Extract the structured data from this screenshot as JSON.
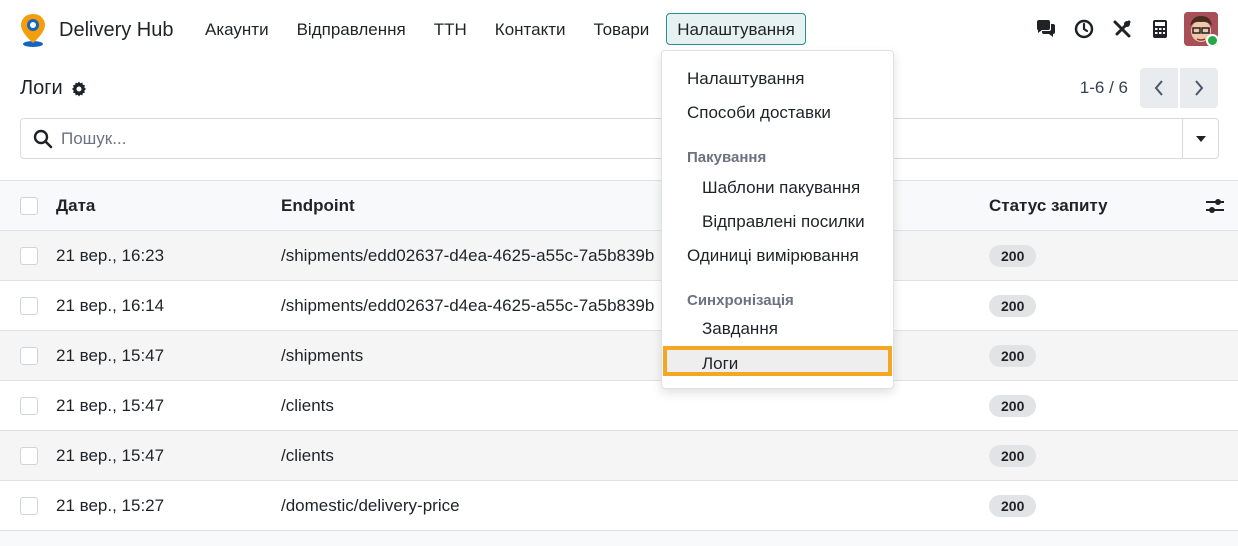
{
  "app": {
    "name": "Delivery Hub"
  },
  "nav": {
    "menu": [
      {
        "label": "Акаунти",
        "active": false
      },
      {
        "label": "Відправлення",
        "active": false
      },
      {
        "label": "ТТН",
        "active": false
      },
      {
        "label": "Контакти",
        "active": false
      },
      {
        "label": "Товари",
        "active": false
      },
      {
        "label": "Налаштування",
        "active": true
      }
    ],
    "icons": [
      "chat-icon",
      "clock-icon",
      "tools-icon",
      "calculator-icon",
      "user-avatar"
    ]
  },
  "page": {
    "title": "Логи",
    "pager": "1-6 / 6"
  },
  "search": {
    "placeholder": "Пошук...",
    "value": ""
  },
  "table": {
    "columns": {
      "date": "Дата",
      "endpoint": "Endpoint",
      "status": "Статус запиту"
    },
    "rows": [
      {
        "date": "21 вер., 16:23",
        "endpoint": "/shipments/edd02637-d4ea-4625-a55c-7a5b839b",
        "status": "200"
      },
      {
        "date": "21 вер., 16:14",
        "endpoint": "/shipments/edd02637-d4ea-4625-a55c-7a5b839b",
        "status": "200"
      },
      {
        "date": "21 вер., 15:47",
        "endpoint": "/shipments",
        "status": "200"
      },
      {
        "date": "21 вер., 15:47",
        "endpoint": "/clients",
        "status": "200"
      },
      {
        "date": "21 вер., 15:47",
        "endpoint": "/clients",
        "status": "200"
      },
      {
        "date": "21 вер., 15:27",
        "endpoint": "/domestic/delivery-price",
        "status": "200"
      }
    ]
  },
  "dropdown": {
    "settings": "Налаштування",
    "delivery_methods": "Способи доставки",
    "packaging_header": "Пакування",
    "packaging_templates": "Шаблони пакування",
    "sent_parcels": "Відправлені посилки",
    "units": "Одиниці вимірювання",
    "sync_header": "Синхронізація",
    "tasks": "Завдання",
    "logs": "Логи"
  },
  "colors": {
    "accent": "#2a8c8c",
    "highlight": "#f5a623",
    "badge_bg": "#e2e3e5",
    "online": "#28a745"
  }
}
